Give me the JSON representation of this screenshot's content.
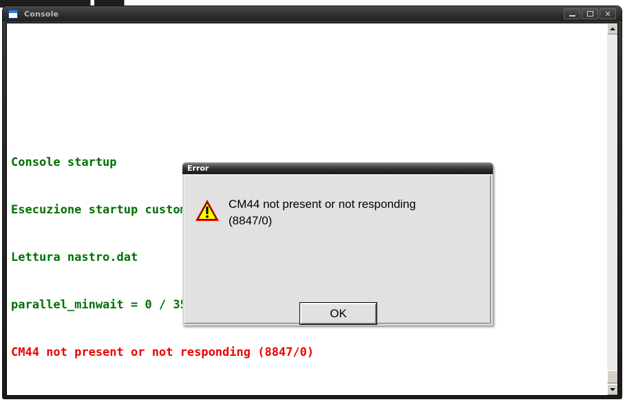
{
  "window": {
    "title": "Console",
    "icon": "window-icon",
    "controls": [
      {
        "name": "minimize",
        "glyph": "minimize-icon",
        "label": "_"
      },
      {
        "name": "maximize",
        "glyph": "maximize-icon",
        "label": "□"
      },
      {
        "name": "close",
        "glyph": "close-icon",
        "label": "X"
      }
    ]
  },
  "console": {
    "lines": [
      {
        "text": "Console startup",
        "color": "#007000"
      },
      {
        "text": "Esecuzione startup custom",
        "color": "#007000"
      },
      {
        "text": "Lettura nastro.dat",
        "color": "#007000"
      },
      {
        "text": "parallel_minwait = 0 / 3579545",
        "color": "#007000"
      },
      {
        "text": "CM44 not present or not responding (8847/0)",
        "color": "#ee0000"
      }
    ],
    "text_colors": {
      "normal": "#007000",
      "error": "#ee0000"
    }
  },
  "scrollbar": {
    "up_arrow": "scroll-up-icon",
    "down_arrow": "scroll-down-icon",
    "thumb": "scrollbar-thumb"
  },
  "dialog": {
    "title": "Error",
    "icon": "warning-icon",
    "message_lines": [
      "CM44 not present or not responding",
      "(8847/0)"
    ],
    "ok_label": "OK",
    "colors": {
      "face": "#e1e1e1",
      "warning_fill": "#ffff00",
      "warning_border": "#ee0000"
    }
  }
}
